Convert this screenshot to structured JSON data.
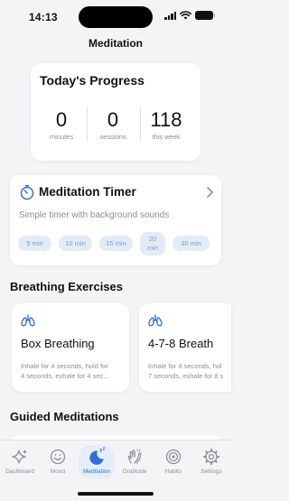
{
  "status_bar": {
    "time": "14:13"
  },
  "nav": {
    "title": "Meditation"
  },
  "progress": {
    "title": "Today's Progress",
    "stats": [
      {
        "value": "0",
        "label": "minutes"
      },
      {
        "value": "0",
        "label": "sessions"
      },
      {
        "value": "118",
        "label": "this week"
      }
    ]
  },
  "timer": {
    "title": "Meditation Timer",
    "subtitle": "Simple timer with background sounds",
    "icon": "timer-icon",
    "durations": [
      "5 min",
      "10 min",
      "15 min",
      "20\nmin",
      "30 min"
    ]
  },
  "breathing": {
    "section_title": "Breathing Exercises",
    "exercises": [
      {
        "title": "Box Breathing",
        "desc_line1": "Inhale for 4 seconds, hold for",
        "desc_line2": "4 seconds, exhale for 4 sec..."
      },
      {
        "title": "4-7-8 Breath",
        "desc_line1": "Inhale for 4 seconds, hol",
        "desc_line2": "7 seconds, exhale for 8 s"
      }
    ]
  },
  "guided": {
    "section_title": "Guided Meditations"
  },
  "tabs": [
    {
      "label": "Dashboard",
      "icon": "sparkles-icon"
    },
    {
      "label": "Mood",
      "icon": "smiley-icon"
    },
    {
      "label": "Meditation",
      "icon": "moon-zzz-icon",
      "active": true
    },
    {
      "label": "Gratitude",
      "icon": "hands-clap-icon"
    },
    {
      "label": "Habits",
      "icon": "target-icon"
    },
    {
      "label": "Settings",
      "icon": "gear-icon"
    }
  ],
  "colors": {
    "accent": "#2f6ed6",
    "chip_bg": "#e3ecf6",
    "chip_text": "#6f9fd1",
    "secondary_text": "#8e8e93",
    "background": "#f4f4f7"
  }
}
